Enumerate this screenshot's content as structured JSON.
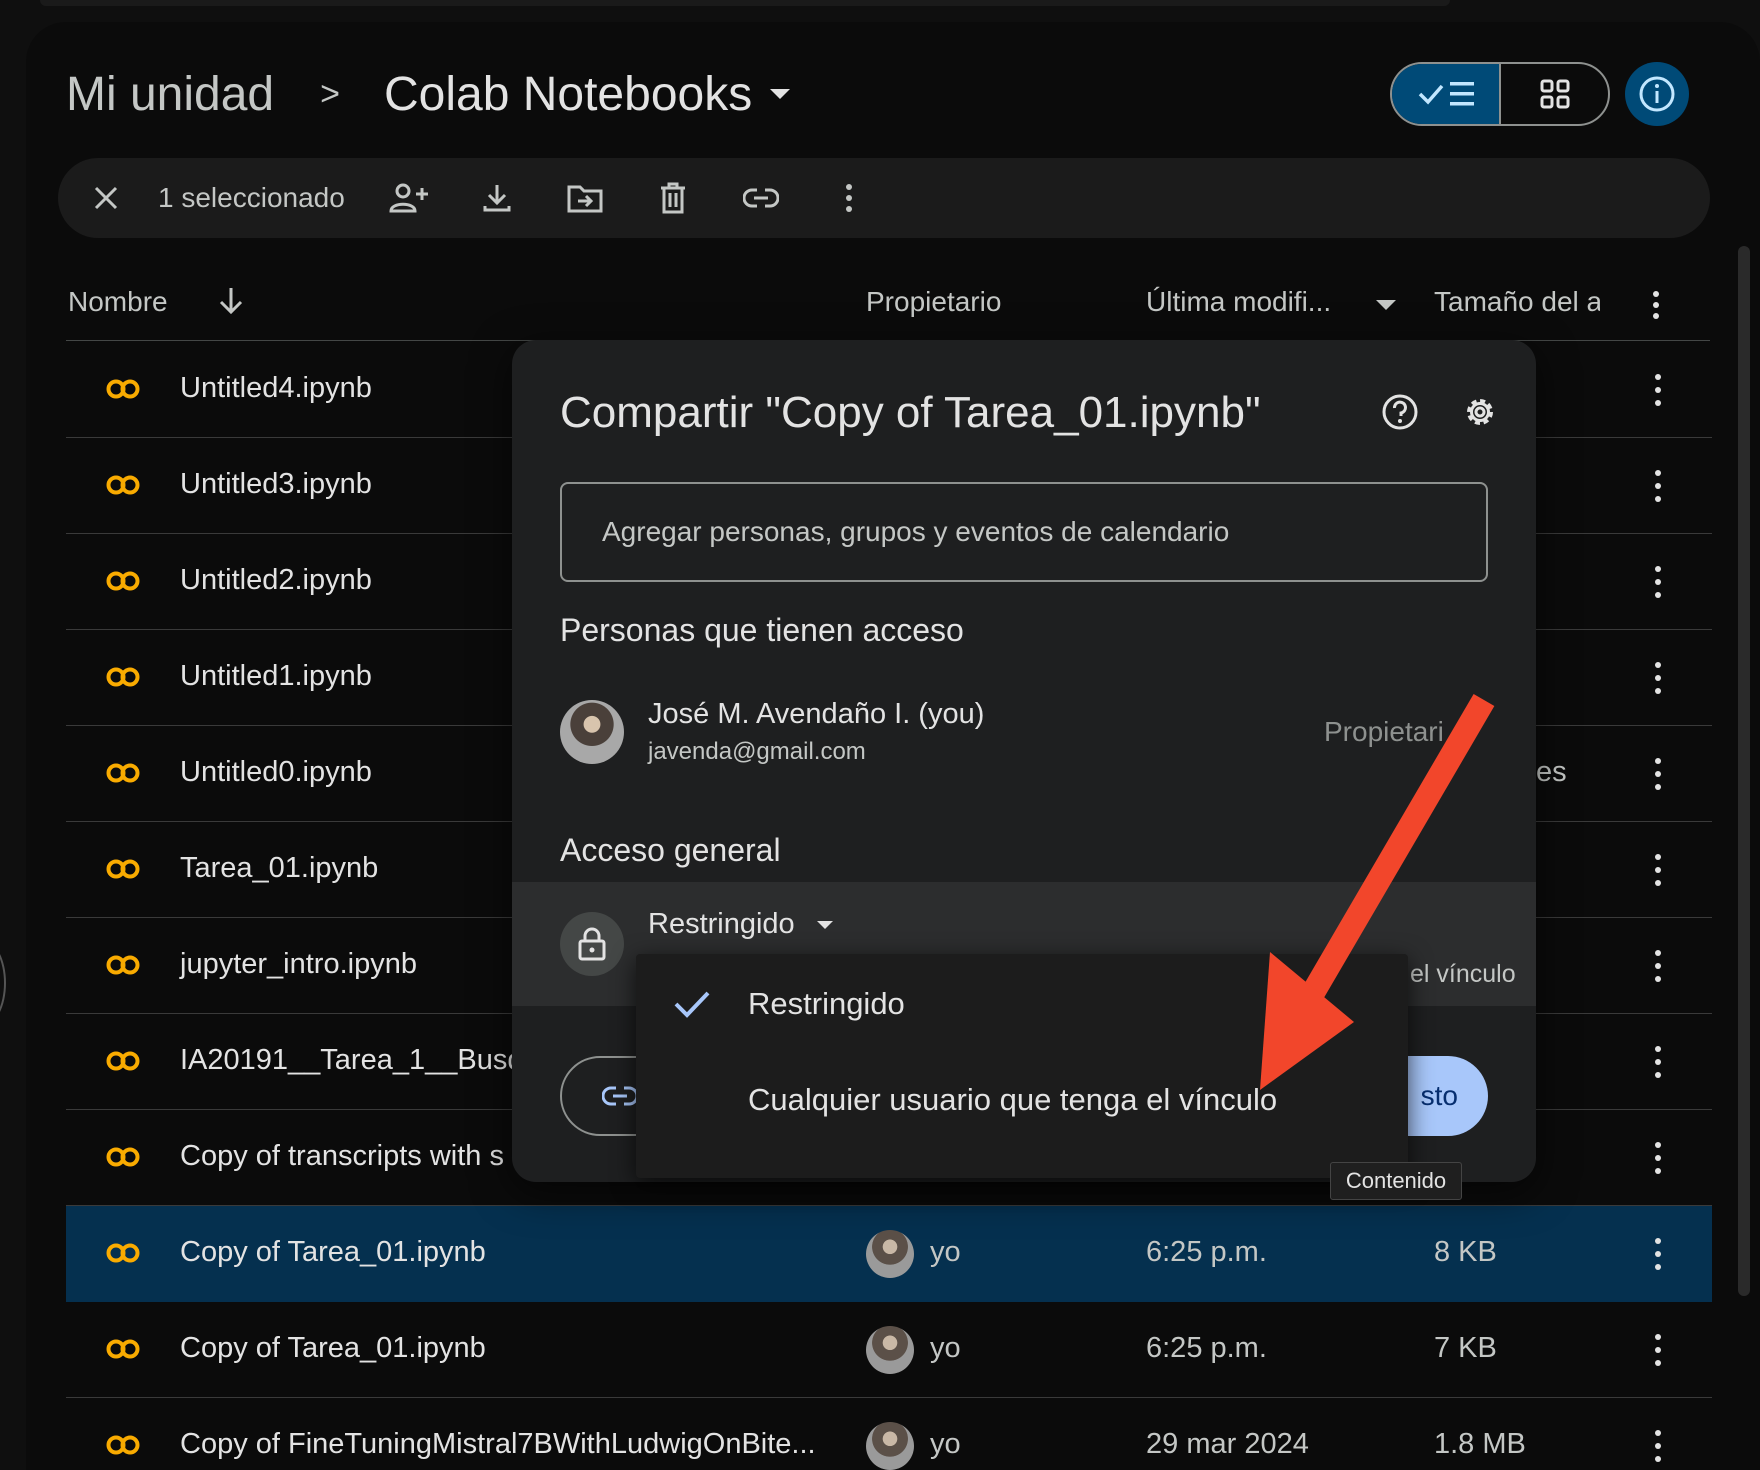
{
  "breadcrumb": {
    "root": "Mi unidad",
    "separator": ">",
    "current": "Colab Notebooks"
  },
  "selection_bar": {
    "count_label": "1 seleccionado"
  },
  "columns": {
    "name": "Nombre",
    "owner": "Propietario",
    "modified": "Última modifi...",
    "size": "Tamaño del a"
  },
  "files": [
    {
      "name": "Untitled4.ipynb"
    },
    {
      "name": "Untitled3.ipynb"
    },
    {
      "name": "Untitled2.ipynb"
    },
    {
      "name": "Untitled1.ipynb"
    },
    {
      "name": "Untitled0.ipynb",
      "peek": "es"
    },
    {
      "name": "Tarea_01.ipynb"
    },
    {
      "name": "jupyter_intro.ipynb"
    },
    {
      "name": "IA20191__Tarea_1__Busqu"
    },
    {
      "name": "Copy of transcripts with s"
    },
    {
      "name": "Copy of Tarea_01.ipynb",
      "owner": "yo",
      "modified": "6:25 p.m.",
      "size": "8 KB",
      "selected": true
    },
    {
      "name": "Copy of Tarea_01.ipynb",
      "owner": "yo",
      "modified": "6:25 p.m.",
      "size": "7 KB"
    },
    {
      "name": "Copy of FineTuningMistral7BWithLudwigOnBite...",
      "owner": "yo",
      "modified": "29 mar 2024",
      "size": "1.8 MB"
    }
  ],
  "share_dialog": {
    "title": "Compartir \"Copy of Tarea_01.ipynb\"",
    "input_placeholder": "Agregar personas, grupos y eventos de calendario",
    "people_heading": "Personas que tienen acceso",
    "person": {
      "name": "José M. Avendaño I. (you)",
      "email": "javenda@gmail.com",
      "role": "Propietari"
    },
    "general_access_heading": "Acceso general",
    "access_value": "Restringido",
    "access_hint": "el vínculo",
    "done_label": "sto"
  },
  "access_menu": {
    "options": [
      {
        "label": "Restringido",
        "checked": true
      },
      {
        "label": "Cualquier usuario que tenga el vínculo",
        "checked": false
      }
    ]
  },
  "tooltip": "Contenido",
  "colors": {
    "accent": "#a8c7fa",
    "selected_row": "#05304f",
    "annotation_arrow": "#f2462b",
    "colab_orange": "#f9ab00"
  }
}
